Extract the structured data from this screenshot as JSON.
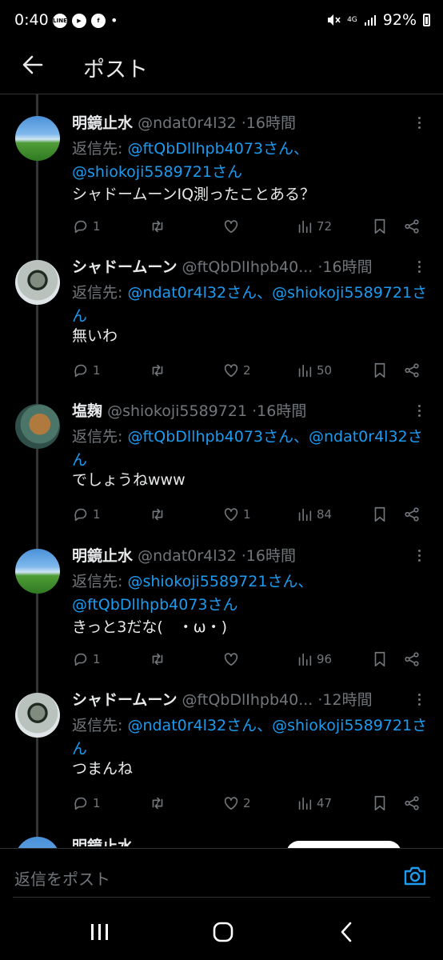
{
  "status_bar": {
    "time": "0:40",
    "apps": [
      "LINE",
      "▶",
      "f"
    ],
    "bullet": "•",
    "network": "4G",
    "battery": "92%"
  },
  "header": {
    "title": "ポスト"
  },
  "tweets": [
    {
      "name": "明鏡止水",
      "handle": "@ndat0r4l32",
      "time": "16時間",
      "avatar": "landscape",
      "reply_prefix": "返信先: ",
      "reply_mentions": "@ftQbDllhpb4073さん、@shiokoji5589721さん",
      "text": "シャドームーンIQ測ったことある？",
      "replies": "1",
      "retweets": "",
      "likes": "",
      "views": "72"
    },
    {
      "name": "シャドームーン",
      "handle": "@ftQbDlIhpb40...",
      "time": "16時間",
      "avatar": "robot",
      "reply_prefix": "返信先: ",
      "reply_mentions": "@ndat0r4l32さん、@shiokoji5589721さん",
      "text": "無いわ",
      "replies": "1",
      "retweets": "",
      "likes": "2",
      "views": "50"
    },
    {
      "name": "塩麹",
      "handle": "@shiokoji5589721",
      "time": "16時間",
      "avatar": "food",
      "reply_prefix": "返信先: ",
      "reply_mentions": "@ftQbDllhpb4073さん、@ndat0r4l32さん",
      "text": "でしょうねwww",
      "replies": "1",
      "retweets": "",
      "likes": "1",
      "views": "84"
    },
    {
      "name": "明鏡止水",
      "handle": "@ndat0r4l32",
      "time": "16時間",
      "avatar": "landscape",
      "reply_prefix": "返信先: ",
      "reply_mentions": "@shiokoji5589721さん、@ftQbDllhpb4073さん",
      "text": "きっと3だな(　・ω・)",
      "replies": "1",
      "retweets": "",
      "likes": "",
      "views": "96"
    },
    {
      "name": "シャドームーン",
      "handle": "@ftQbDlIhpb40...",
      "time": "12時間",
      "avatar": "robot",
      "reply_prefix": "返信先: ",
      "reply_mentions": "@ndat0r4l32さん、@shiokoji5589721さん",
      "text": "つまんね",
      "replies": "1",
      "retweets": "",
      "likes": "2",
      "views": "47"
    }
  ],
  "next_tweet": {
    "name": "明鏡止水"
  },
  "compose": {
    "placeholder": "返信をポスト"
  },
  "colors": {
    "accent": "#1d9bf0",
    "muted": "#71767b",
    "text": "#e7e9ea",
    "background": "#000000"
  }
}
